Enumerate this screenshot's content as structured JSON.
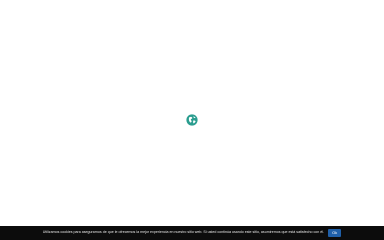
{
  "loader": {
    "icon": "globe-icon",
    "color": "#2a9d8f"
  },
  "cookie_bar": {
    "message": "Utilizamos cookies para asegurarnos de que le ofrecemos la mejor experiencia en nuestro sitio web. Si usted continúa usando este sitio, asumiremos que está satisfecho con él.",
    "ok_label": "Ok",
    "background": "#0c0c0c",
    "button_color": "#1f5fa8"
  }
}
